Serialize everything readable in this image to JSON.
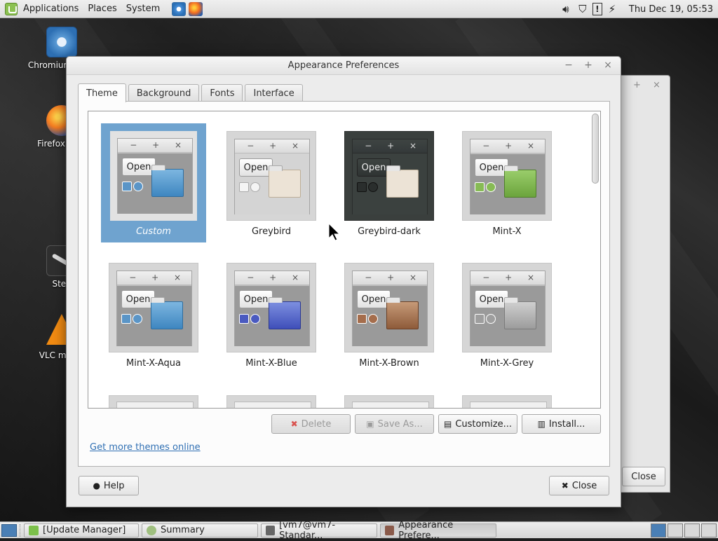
{
  "top_panel": {
    "menus": [
      "Applications",
      "Places",
      "System"
    ],
    "clock": "Thu Dec 19, 05:53"
  },
  "desktop_icons": [
    {
      "label": "Chromium Brow",
      "icon": "chromium-icon"
    },
    {
      "label": "Firefox Web",
      "icon": "firefox-icon"
    },
    {
      "label": "Stea",
      "icon": "steam-icon"
    },
    {
      "label": "VLC media",
      "icon": "vlc-icon"
    }
  ],
  "background_window": {
    "close_label": "Close"
  },
  "window": {
    "title": "Appearance Preferences",
    "tabs": [
      "Theme",
      "Background",
      "Fonts",
      "Interface"
    ],
    "active_tab": "Theme",
    "themes": [
      {
        "name": "Custom",
        "selected": true
      },
      {
        "name": "Greybird"
      },
      {
        "name": "Greybird-dark"
      },
      {
        "name": "Mint-X"
      },
      {
        "name": "Mint-X-Aqua"
      },
      {
        "name": "Mint-X-Blue"
      },
      {
        "name": "Mint-X-Brown"
      },
      {
        "name": "Mint-X-Grey"
      }
    ],
    "preview_button_label": "Open",
    "preview_controls": "− + ×",
    "buttons": {
      "delete": "Delete",
      "save_as": "Save As...",
      "customize": "Customize...",
      "install": "Install..."
    },
    "link": "Get more themes online",
    "help": "Help",
    "close": "Close"
  },
  "taskbar": {
    "tasks": [
      "[Update Manager]",
      "Summary",
      "[vm7@vm7-Standar...",
      "Appearance Prefere..."
    ]
  },
  "colors": {
    "selection": "#6fa3cf",
    "link": "#2f6fb3",
    "delete_icon": "#d9534f"
  }
}
